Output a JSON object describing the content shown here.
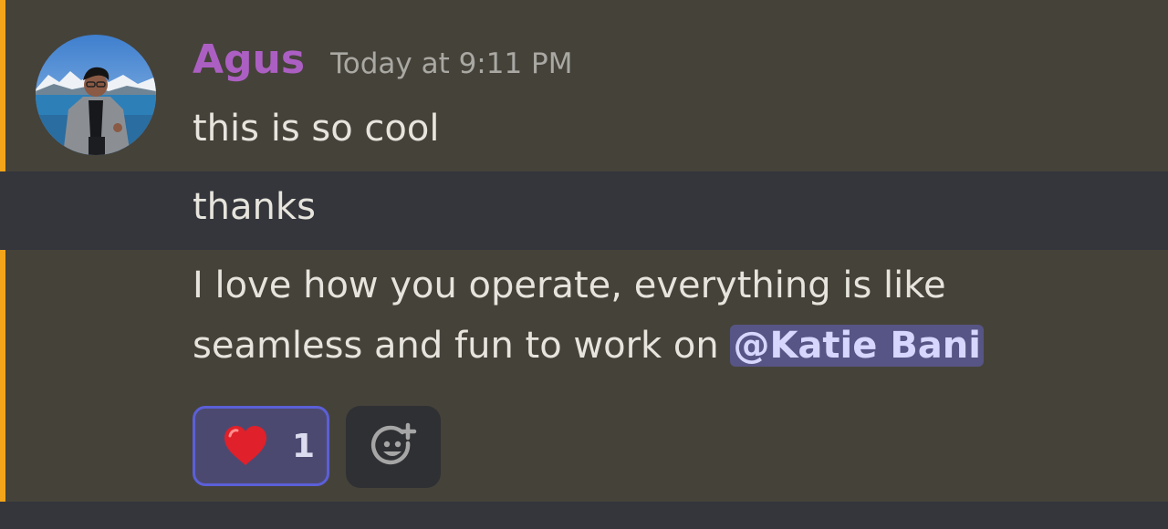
{
  "message": {
    "author": "Agus",
    "timestamp": "Today at 9:11 PM",
    "lines": [
      "this is so cool",
      "thanks",
      "I love how you operate, everything is like",
      "seamless and fun to work on "
    ],
    "mention": "@Katie Bani"
  },
  "reactions": [
    {
      "emoji": "heart-icon",
      "count": "1"
    }
  ],
  "add_reaction": {
    "icon": "add-reaction-icon"
  },
  "colors": {
    "mention_highlight_bar": "#f2a51a",
    "username": "#ac5fc2",
    "mention_bg": "#575585",
    "reaction_border": "#5b5fd8"
  }
}
